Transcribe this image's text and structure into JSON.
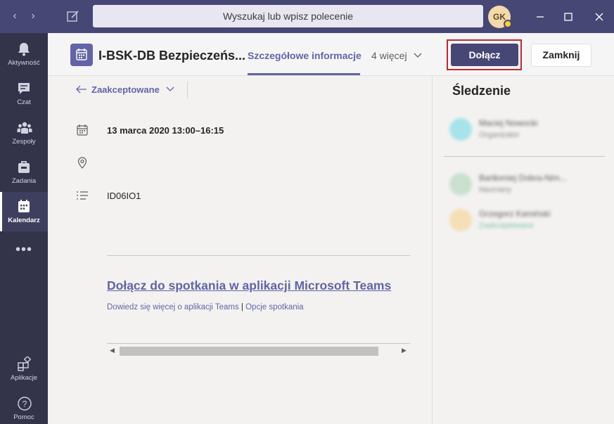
{
  "titlebar": {
    "search_placeholder": "Wyszukaj lub wpisz polecenie",
    "avatar_initials": "GK",
    "status_color": "#f8d22a"
  },
  "rail": {
    "items": [
      {
        "label": "Aktywność",
        "icon": "bell-icon"
      },
      {
        "label": "Czat",
        "icon": "chat-icon"
      },
      {
        "label": "Zespoły",
        "icon": "teams-icon"
      },
      {
        "label": "Zadania",
        "icon": "briefcase-icon"
      },
      {
        "label": "Kalendarz",
        "icon": "calendar-icon",
        "active": true
      }
    ],
    "more": "•••",
    "bottom_items": [
      {
        "label": "Aplikacje",
        "icon": "apps-icon"
      },
      {
        "label": "Pomoc",
        "icon": "help-icon"
      }
    ]
  },
  "header": {
    "title": "I-BSK-DB Bezpieczeńs...",
    "tab_active": "Szczegółowe informacje",
    "tab_more": "4 więcej",
    "join_label": "Dołącz",
    "close_label": "Zamknij"
  },
  "details": {
    "rsvp": "Zaakceptowane",
    "datetime": "13 marca 2020 13:00–16:15",
    "location": "",
    "description": "ID06IO1",
    "join_link": "Dołącz do spotkania w aplikacji Microsoft Teams",
    "learn_more": "Dowiedz się więcej o aplikacji Teams",
    "separator": "|",
    "meeting_options": "Opcje spotkania"
  },
  "tracking": {
    "title": "Śledzenie",
    "attendees": [
      {
        "name": "Maciej Nowocki",
        "status": "Organizator",
        "avatar_color": "#a6e3ea",
        "status_color": "#8a8886"
      },
      {
        "name": "Bartłomiej Dobra-Nim...",
        "status": "Nieznany",
        "avatar_color": "#c9e0cf",
        "status_color": "#8a8886"
      },
      {
        "name": "Grzegorz Kamiński",
        "status": "Zaakceptowane",
        "avatar_color": "#f5dfb6",
        "status_color": "#7cc4a0"
      }
    ]
  },
  "colors": {
    "brand": "#6264a7",
    "titlebar": "#464775",
    "rail": "#33344a",
    "highlight": "#c4262e"
  }
}
